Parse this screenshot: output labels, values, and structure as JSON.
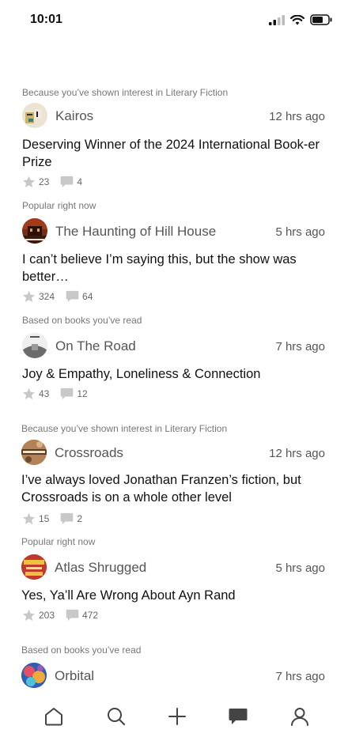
{
  "status_bar": {
    "time": "10:01"
  },
  "feed": [
    {
      "reason": "Because you’ve shown interest in Literary Fiction",
      "book": "Kairos",
      "time_ago": "12 hrs ago",
      "title": "Deserving Winner of the 2024 International Book-er Prize",
      "likes": "23",
      "comments": "4",
      "avatar_color": "#e6dcc8"
    },
    {
      "reason": "Popular right now",
      "book": "The Haunting of Hill House",
      "time_ago": "5 hrs ago",
      "title": "I can’t believe I’m saying this, but the show was better…",
      "likes": "324",
      "comments": "64",
      "avatar_color": "#7a2a18"
    },
    {
      "reason": "Based on books you’ve read",
      "book": "On The Road",
      "time_ago": "7 hrs ago",
      "title": "Joy & Empathy, Loneliness & Connection",
      "likes": "43",
      "comments": "12",
      "avatar_color": "#d8d8d8"
    },
    {
      "reason": "Because you’ve shown interest in Literary Fiction",
      "book": "Crossroads",
      "time_ago": "12 hrs ago",
      "title": "I’ve always loved Jonathan Franzen’s fiction, but Crossroads is on a whole other level",
      "likes": "15",
      "comments": "2",
      "avatar_color": "#9c6b44"
    },
    {
      "reason": "Popular right now",
      "book": "Atlas Shrugged",
      "time_ago": "5 hrs ago",
      "title": "Yes, Ya’ll Are Wrong About Ayn Rand",
      "likes": "203",
      "comments": "472",
      "avatar_color": "#c0392b"
    },
    {
      "reason": "Based on books you’ve read",
      "book": "Orbital",
      "time_ago": "7 hrs ago",
      "title": "",
      "likes": "",
      "comments": "",
      "avatar_color": "#3a7bd5"
    }
  ],
  "nav": [
    "home-icon",
    "search-icon",
    "plus-icon",
    "chat-icon",
    "profile-icon"
  ]
}
